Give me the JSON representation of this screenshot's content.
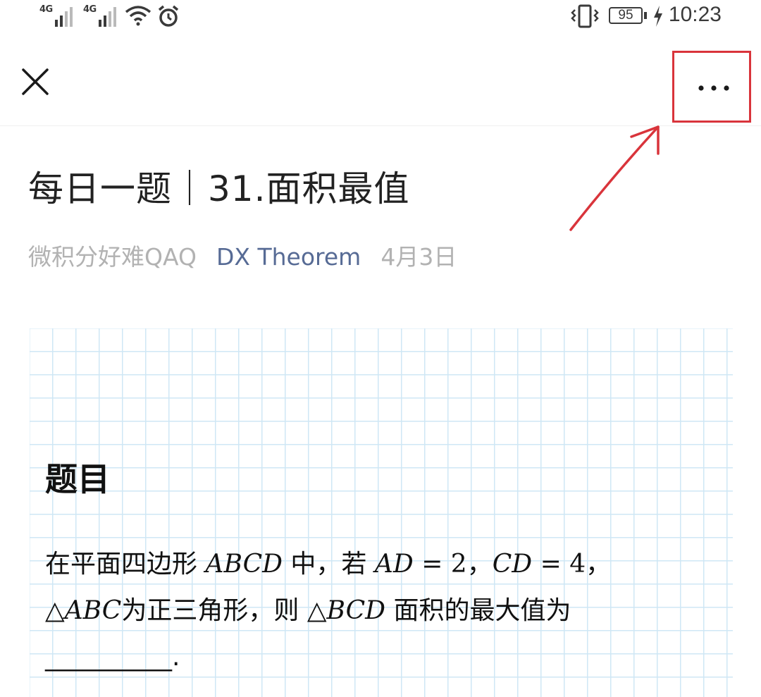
{
  "status_bar": {
    "signal1_label": "4G",
    "signal2_label": "4G",
    "battery": "95",
    "time": "10:23",
    "icons": [
      "signal-icon",
      "signal-icon",
      "wifi-icon",
      "alarm-icon",
      "vibrate-icon",
      "battery-icon",
      "charging-icon"
    ]
  },
  "nav": {
    "close_icon": "close-icon",
    "more_icon": "more-icon",
    "highlight_color": "#d9343b"
  },
  "article": {
    "title": "每日一题｜31.面积最值",
    "author": "微积分好难QAQ",
    "account": "DX Theorem",
    "date": "4月3日",
    "account_color": "#576b95"
  },
  "content": {
    "heading": "题目",
    "line1_a": "在平面四边形 ",
    "line1_m1": "ABCD",
    "line1_b": " 中，若 ",
    "line1_m2": "AD",
    "line1_eq1": " = 2",
    "line1_c": "，",
    "line1_m3": "CD",
    "line1_eq2": " = 4",
    "line1_d": "，",
    "line2_tri1": "△",
    "line2_m1": "ABC",
    "line2_a": "为正三角形，则 ",
    "line2_tri2": "△",
    "line2_m2": "BCD",
    "line2_b": " 面积的最大值为",
    "line3_blank": "__________",
    "line3_end": "."
  }
}
